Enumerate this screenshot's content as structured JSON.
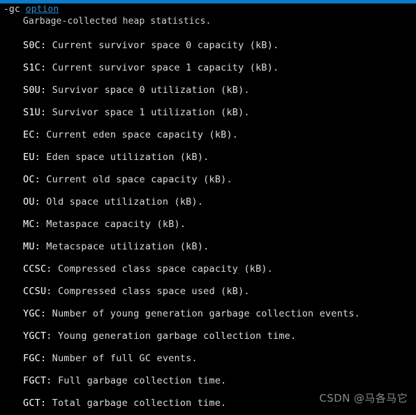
{
  "terminal": {
    "background_color": "#000000",
    "text_color": "#e4e4e4",
    "top_bar_color": "#0b7ac9",
    "link_color": "#2d8fdd"
  },
  "command": {
    "flag": "-gc ",
    "link_label": "option",
    "description": "Garbage-collected heap statistics."
  },
  "fields": [
    {
      "key": "S0C:",
      "desc": " Current survivor space 0 capacity (kB)."
    },
    {
      "key": "S1C:",
      "desc": " Current survivor space 1 capacity (kB)."
    },
    {
      "key": "S0U:",
      "desc": " Survivor space 0 utilization (kB)."
    },
    {
      "key": "S1U:",
      "desc": " Survivor space 1 utilization (kB)."
    },
    {
      "key": "EC:",
      "desc": " Current eden space capacity (kB)."
    },
    {
      "key": "EU:",
      "desc": " Eden space utilization (kB)."
    },
    {
      "key": "OC:",
      "desc": " Current old space capacity (kB)."
    },
    {
      "key": "OU:",
      "desc": " Old space utilization (kB)."
    },
    {
      "key": "MC:",
      "desc": " Metaspace capacity (kB)."
    },
    {
      "key": "MU:",
      "desc": " Metacspace utilization (kB)."
    },
    {
      "key": "CCSC:",
      "desc": " Compressed class space capacity (kB)."
    },
    {
      "key": "CCSU:",
      "desc": " Compressed class space used (kB)."
    },
    {
      "key": "YGC:",
      "desc": " Number of young generation garbage collection events."
    },
    {
      "key": "YGCT:",
      "desc": " Young generation garbage collection time."
    },
    {
      "key": "FGC:",
      "desc": " Number of full GC events."
    },
    {
      "key": "FGCT:",
      "desc": " Full garbage collection time."
    },
    {
      "key": "GCT:",
      "desc": " Total garbage collection time."
    }
  ],
  "watermark": {
    "text": "CSDN @马各马它"
  }
}
